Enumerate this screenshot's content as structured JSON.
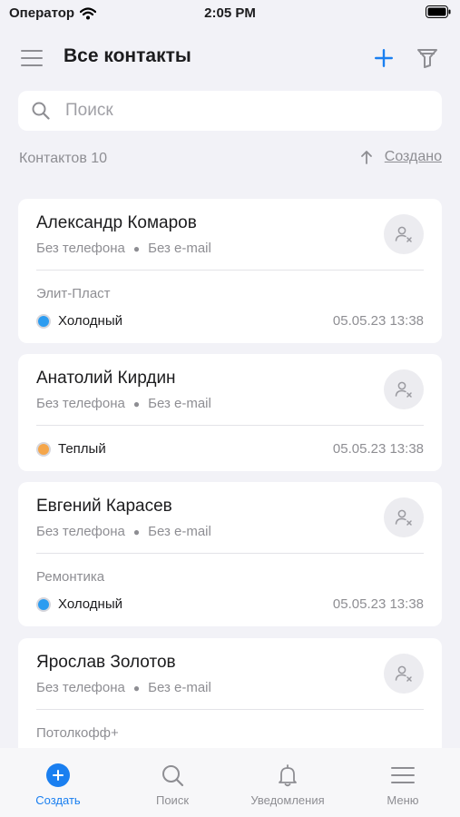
{
  "status_bar": {
    "carrier": "Оператор",
    "time": "2:05 PM"
  },
  "header": {
    "title": "Все контакты"
  },
  "search": {
    "placeholder": "Поиск"
  },
  "list_info": {
    "count_label": "Контактов 10",
    "sort_label": "Создано"
  },
  "contacts": [
    {
      "name": "Александр Комаров",
      "phone": "Без телефона",
      "email": "Без e-mail",
      "company": "Элит-Пласт",
      "status": "Холодный",
      "status_color": "#2d9cf0",
      "date": "05.05.23 13:38"
    },
    {
      "name": "Анатолий Кирдин",
      "phone": "Без телефона",
      "email": "Без e-mail",
      "company": "",
      "status": "Теплый",
      "status_color": "#f5a64a",
      "date": "05.05.23 13:38"
    },
    {
      "name": "Евгений Карасев",
      "phone": "Без телефона",
      "email": "Без e-mail",
      "company": "Ремонтика",
      "status": "Холодный",
      "status_color": "#2d9cf0",
      "date": "05.05.23 13:38"
    },
    {
      "name": "Ярослав Золотов",
      "phone": "Без телефона",
      "email": "Без e-mail",
      "company": "Потолкофф+",
      "status": "",
      "status_color": "",
      "date": ""
    }
  ],
  "tabbar": {
    "items": [
      {
        "label": "Создать",
        "icon": "plus-circle-icon",
        "active": true
      },
      {
        "label": "Поиск",
        "icon": "search-icon",
        "active": false
      },
      {
        "label": "Уведомления",
        "icon": "bell-icon",
        "active": false
      },
      {
        "label": "Меню",
        "icon": "menu-icon",
        "active": false
      }
    ]
  },
  "colors": {
    "accent": "#1a7ff0",
    "background": "#f2f2f7",
    "card": "#ffffff",
    "muted": "#8e8e93"
  }
}
